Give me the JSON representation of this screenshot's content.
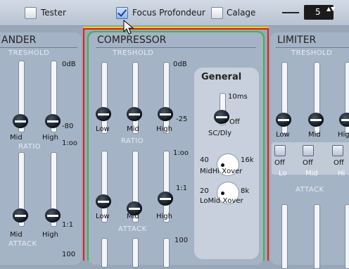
{
  "toolbar": {
    "tester_label": "Tester",
    "focus_label": "Focus Profondeur",
    "calage_label": "Calage",
    "spin_value": "5",
    "spin_arrows": "▲▼"
  },
  "expander": {
    "title": "ANDER",
    "treshold": "TRESHOLD",
    "ratio": "RATIO",
    "attack": "ATTACK",
    "t_top": "0dB",
    "t_bot": "-80",
    "r_top": "1:oo",
    "r_bot": "1:1",
    "a_top": "100",
    "mid": "Mid",
    "high": "High"
  },
  "compressor": {
    "title": "COMPRESSOR",
    "treshold": "TRESHOLD",
    "ratio": "RATIO",
    "attack": "ATTACK",
    "t_top": "0dB",
    "t_bot": "-25",
    "r_top": "1:oo",
    "r_bot": "1:1",
    "a_top": "100",
    "low": "Low",
    "mid": "Mid",
    "high": "High"
  },
  "general": {
    "title": "General",
    "sc_top": "10ms",
    "sc_bot": "Off",
    "sc_label": "SC/Dly",
    "mh_min": "40",
    "mh_max": "16k",
    "mh_label": "MidHi Xover",
    "lm_min": "20",
    "lm_max": "8k",
    "lm_label": "LoMid Xover"
  },
  "limiter": {
    "title": "LIMITER",
    "treshold": "TRESHOLD",
    "attack": "ATTACK",
    "low": "Low",
    "mid": "Mid",
    "high": "High",
    "off": "Off",
    "lo": "Lo",
    "mi": "Mid",
    "hi": "Hi"
  }
}
